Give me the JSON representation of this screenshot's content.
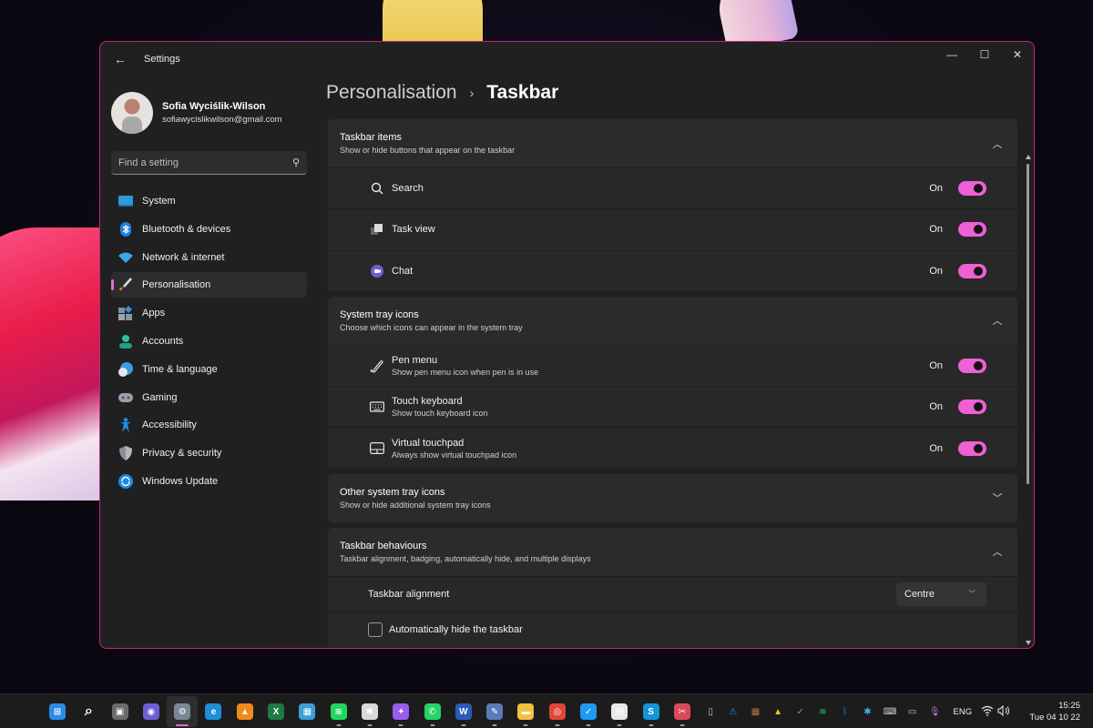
{
  "window": {
    "app_title": "Settings",
    "controls": {
      "minimize": "—",
      "maximize": "☐",
      "close": "✕"
    }
  },
  "profile": {
    "name": "Sofia Wyciślik-Wilson",
    "email": "sofiawycislikwilson@gmail.com"
  },
  "search": {
    "placeholder": "Find a setting"
  },
  "sidebar": {
    "items": [
      {
        "label": "System",
        "icon": "system-icon",
        "color": "#2d9bd8",
        "active": false
      },
      {
        "label": "Bluetooth & devices",
        "icon": "bluetooth-icon",
        "color": "#1f7fe0",
        "active": false
      },
      {
        "label": "Network & internet",
        "icon": "wifi-icon",
        "color": "#3aa8e8",
        "active": false
      },
      {
        "label": "Personalisation",
        "icon": "paintbrush-icon",
        "color": "#d88a3c",
        "active": true
      },
      {
        "label": "Apps",
        "icon": "apps-icon",
        "color": "#6d8fb3",
        "active": false
      },
      {
        "label": "Accounts",
        "icon": "accounts-icon",
        "color": "#2fbfa4",
        "active": false
      },
      {
        "label": "Time & language",
        "icon": "time-language-icon",
        "color": "#3b9de0",
        "active": false
      },
      {
        "label": "Gaming",
        "icon": "gaming-icon",
        "color": "#9aa3ad",
        "active": false
      },
      {
        "label": "Accessibility",
        "icon": "accessibility-icon",
        "color": "#1d8fe0",
        "active": false
      },
      {
        "label": "Privacy & security",
        "icon": "shield-icon",
        "color": "#8a8f96",
        "active": false
      },
      {
        "label": "Windows Update",
        "icon": "windows-update-icon",
        "color": "#1f8ae0",
        "active": false
      }
    ]
  },
  "breadcrumb": {
    "parent": "Personalisation",
    "separator": "›",
    "current": "Taskbar"
  },
  "groups": {
    "taskbar_items": {
      "title": "Taskbar items",
      "subtitle": "Show or hide buttons that appear on the taskbar",
      "expanded": true,
      "rows": [
        {
          "label": "Search",
          "icon": "search-icon",
          "state": "On",
          "on": true
        },
        {
          "label": "Task view",
          "icon": "task-view-icon",
          "state": "On",
          "on": true
        },
        {
          "label": "Chat",
          "icon": "chat-icon",
          "state": "On",
          "on": true
        }
      ]
    },
    "system_tray": {
      "title": "System tray icons",
      "subtitle": "Choose which icons can appear in the system tray",
      "expanded": true,
      "rows": [
        {
          "label": "Pen menu",
          "sub": "Show pen menu icon when pen is in use",
          "icon": "pen-icon",
          "state": "On",
          "on": true
        },
        {
          "label": "Touch keyboard",
          "sub": "Show touch keyboard icon",
          "icon": "keyboard-icon",
          "state": "On",
          "on": true
        },
        {
          "label": "Virtual touchpad",
          "sub": "Always show virtual touchpad icon",
          "icon": "touchpad-icon",
          "state": "On",
          "on": true
        }
      ]
    },
    "other_tray": {
      "title": "Other system tray icons",
      "subtitle": "Show or hide additional system tray icons",
      "expanded": false
    },
    "behaviours": {
      "title": "Taskbar behaviours",
      "subtitle": "Taskbar alignment, badging, automatically hide, and multiple displays",
      "expanded": true,
      "alignment_label": "Taskbar alignment",
      "alignment_value": "Centre",
      "autohide_label": "Automatically hide the taskbar",
      "autohide_checked": false
    }
  },
  "taskbar": {
    "apps": [
      {
        "name": "start",
        "glyph": "⊞",
        "color": "#2b8ce6"
      },
      {
        "name": "search",
        "glyph": "⌕",
        "color": "transparent"
      },
      {
        "name": "task-view",
        "glyph": "▣",
        "color": "#6b6b6b"
      },
      {
        "name": "chat",
        "glyph": "◉",
        "color": "#6b5fd6"
      },
      {
        "name": "settings",
        "glyph": "⚙",
        "color": "#7a8796",
        "active": true
      },
      {
        "name": "edge",
        "glyph": "e",
        "color": "#1d8fd8",
        "running": false
      },
      {
        "name": "vlc",
        "glyph": "▲",
        "color": "#f08a1c"
      },
      {
        "name": "excel",
        "glyph": "X",
        "color": "#1e7a45"
      },
      {
        "name": "buildings",
        "glyph": "▦",
        "color": "#3aa0d8"
      },
      {
        "name": "spotify",
        "glyph": "≋",
        "color": "#1ed760",
        "running": true
      },
      {
        "name": "slack",
        "glyph": "✱",
        "color": "#d9d9d9",
        "running": true
      },
      {
        "name": "messenger",
        "glyph": "✦",
        "color": "#9a5cf0",
        "running": true
      },
      {
        "name": "whatsapp",
        "glyph": "✆",
        "color": "#25d366",
        "running": true
      },
      {
        "name": "word",
        "glyph": "W",
        "color": "#2b5bb8",
        "running": true
      },
      {
        "name": "paint",
        "glyph": "✎",
        "color": "#5a7ab8",
        "running": true
      },
      {
        "name": "file-explorer",
        "glyph": "▬",
        "color": "#f3c03a",
        "running": true
      },
      {
        "name": "chrome",
        "glyph": "◎",
        "color": "#e0463a",
        "running": true
      },
      {
        "name": "twitter",
        "glyph": "✓",
        "color": "#1d9bf0",
        "running": true
      },
      {
        "name": "store",
        "glyph": "▤",
        "color": "#e8e8e8",
        "running": true
      },
      {
        "name": "skype",
        "glyph": "S",
        "color": "#1296d8",
        "running": true
      },
      {
        "name": "snipping-tool",
        "glyph": "✂",
        "color": "#d94a5a",
        "running": true
      }
    ],
    "tray": [
      {
        "name": "usb-icon",
        "glyph": "▯",
        "color": "#cfcfcf"
      },
      {
        "name": "defender-warning-icon",
        "glyph": "⚠",
        "color": "#2a86d8"
      },
      {
        "name": "app-tray-icon",
        "glyph": "▦",
        "color": "#b07a40"
      },
      {
        "name": "google-drive-icon",
        "glyph": "▲",
        "color": "#f4c430"
      },
      {
        "name": "check-app-icon",
        "glyph": "✓",
        "color": "#5bb83a"
      },
      {
        "name": "spotify-tray-icon",
        "glyph": "≋",
        "color": "#1ed760"
      },
      {
        "name": "bluetooth-tray-icon",
        "glyph": "ᛒ",
        "color": "#2b7fe0"
      },
      {
        "name": "slack-tray-icon",
        "glyph": "✱",
        "color": "#3ab5e0"
      },
      {
        "name": "keyboard-tray-icon",
        "glyph": "⌨",
        "color": "#cfcfcf"
      },
      {
        "name": "touchpad-tray-icon",
        "glyph": "▭",
        "color": "#cfcfcf"
      },
      {
        "name": "microphone-icon",
        "glyph": "🎙",
        "color": "#c07ad8"
      }
    ],
    "language": "ENG",
    "time": "15:25",
    "date": "Tue 04 10 22"
  }
}
